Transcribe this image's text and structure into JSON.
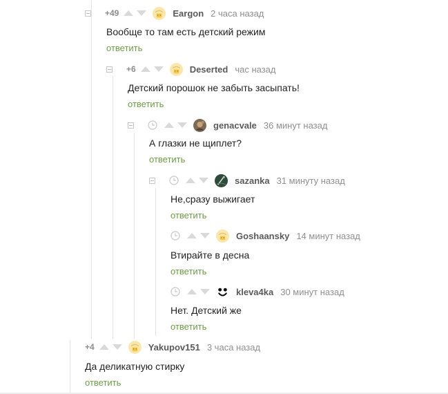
{
  "colors": {
    "reply_link": "#6d9b49",
    "author": "#5a5a5a",
    "meta": "#8f8f8f",
    "vote_arrow": "#d9d9d9",
    "thread_line": "#e3e3e3"
  },
  "comments": [
    {
      "rating": "+49",
      "author": "Eargon",
      "time": "2 часа назад",
      "text": "Вообще то там есть детский режим",
      "reply": "ответить",
      "avatar_icon": "default-user-avatar-icon"
    },
    {
      "rating": "+6",
      "author": "Deserted",
      "time": "час назад",
      "text": "Детский порошок не забыть засыпать!",
      "reply": "ответить",
      "avatar_icon": "default-user-avatar-icon"
    },
    {
      "rating": "",
      "author": "genacvale",
      "time": "36 минут назад",
      "text": "А глазки не щиплет?",
      "reply": "ответить",
      "avatar_icon": "photo-avatar-icon"
    },
    {
      "rating": "",
      "author": "sazanka",
      "time": "31 минуту назад",
      "text": "Не,сразу выжигает",
      "reply": "ответить",
      "avatar_icon": "photo-avatar-icon"
    },
    {
      "rating": "",
      "author": "Goshaansky",
      "time": "14 минут назад",
      "text": "Втирайте в десна",
      "reply": "ответить",
      "avatar_icon": "default-user-avatar-icon"
    },
    {
      "rating": "",
      "author": "kleva4ka",
      "time": "30 минут назад",
      "text": "Нет. Детский же",
      "reply": "ответить",
      "avatar_icon": "smiley-avatar-icon"
    },
    {
      "rating": "+4",
      "author": "Yakupov151",
      "time": "3 часа назад",
      "text": "Да деликатную стирку",
      "reply": "ответить",
      "avatar_icon": "default-user-avatar-icon"
    }
  ]
}
